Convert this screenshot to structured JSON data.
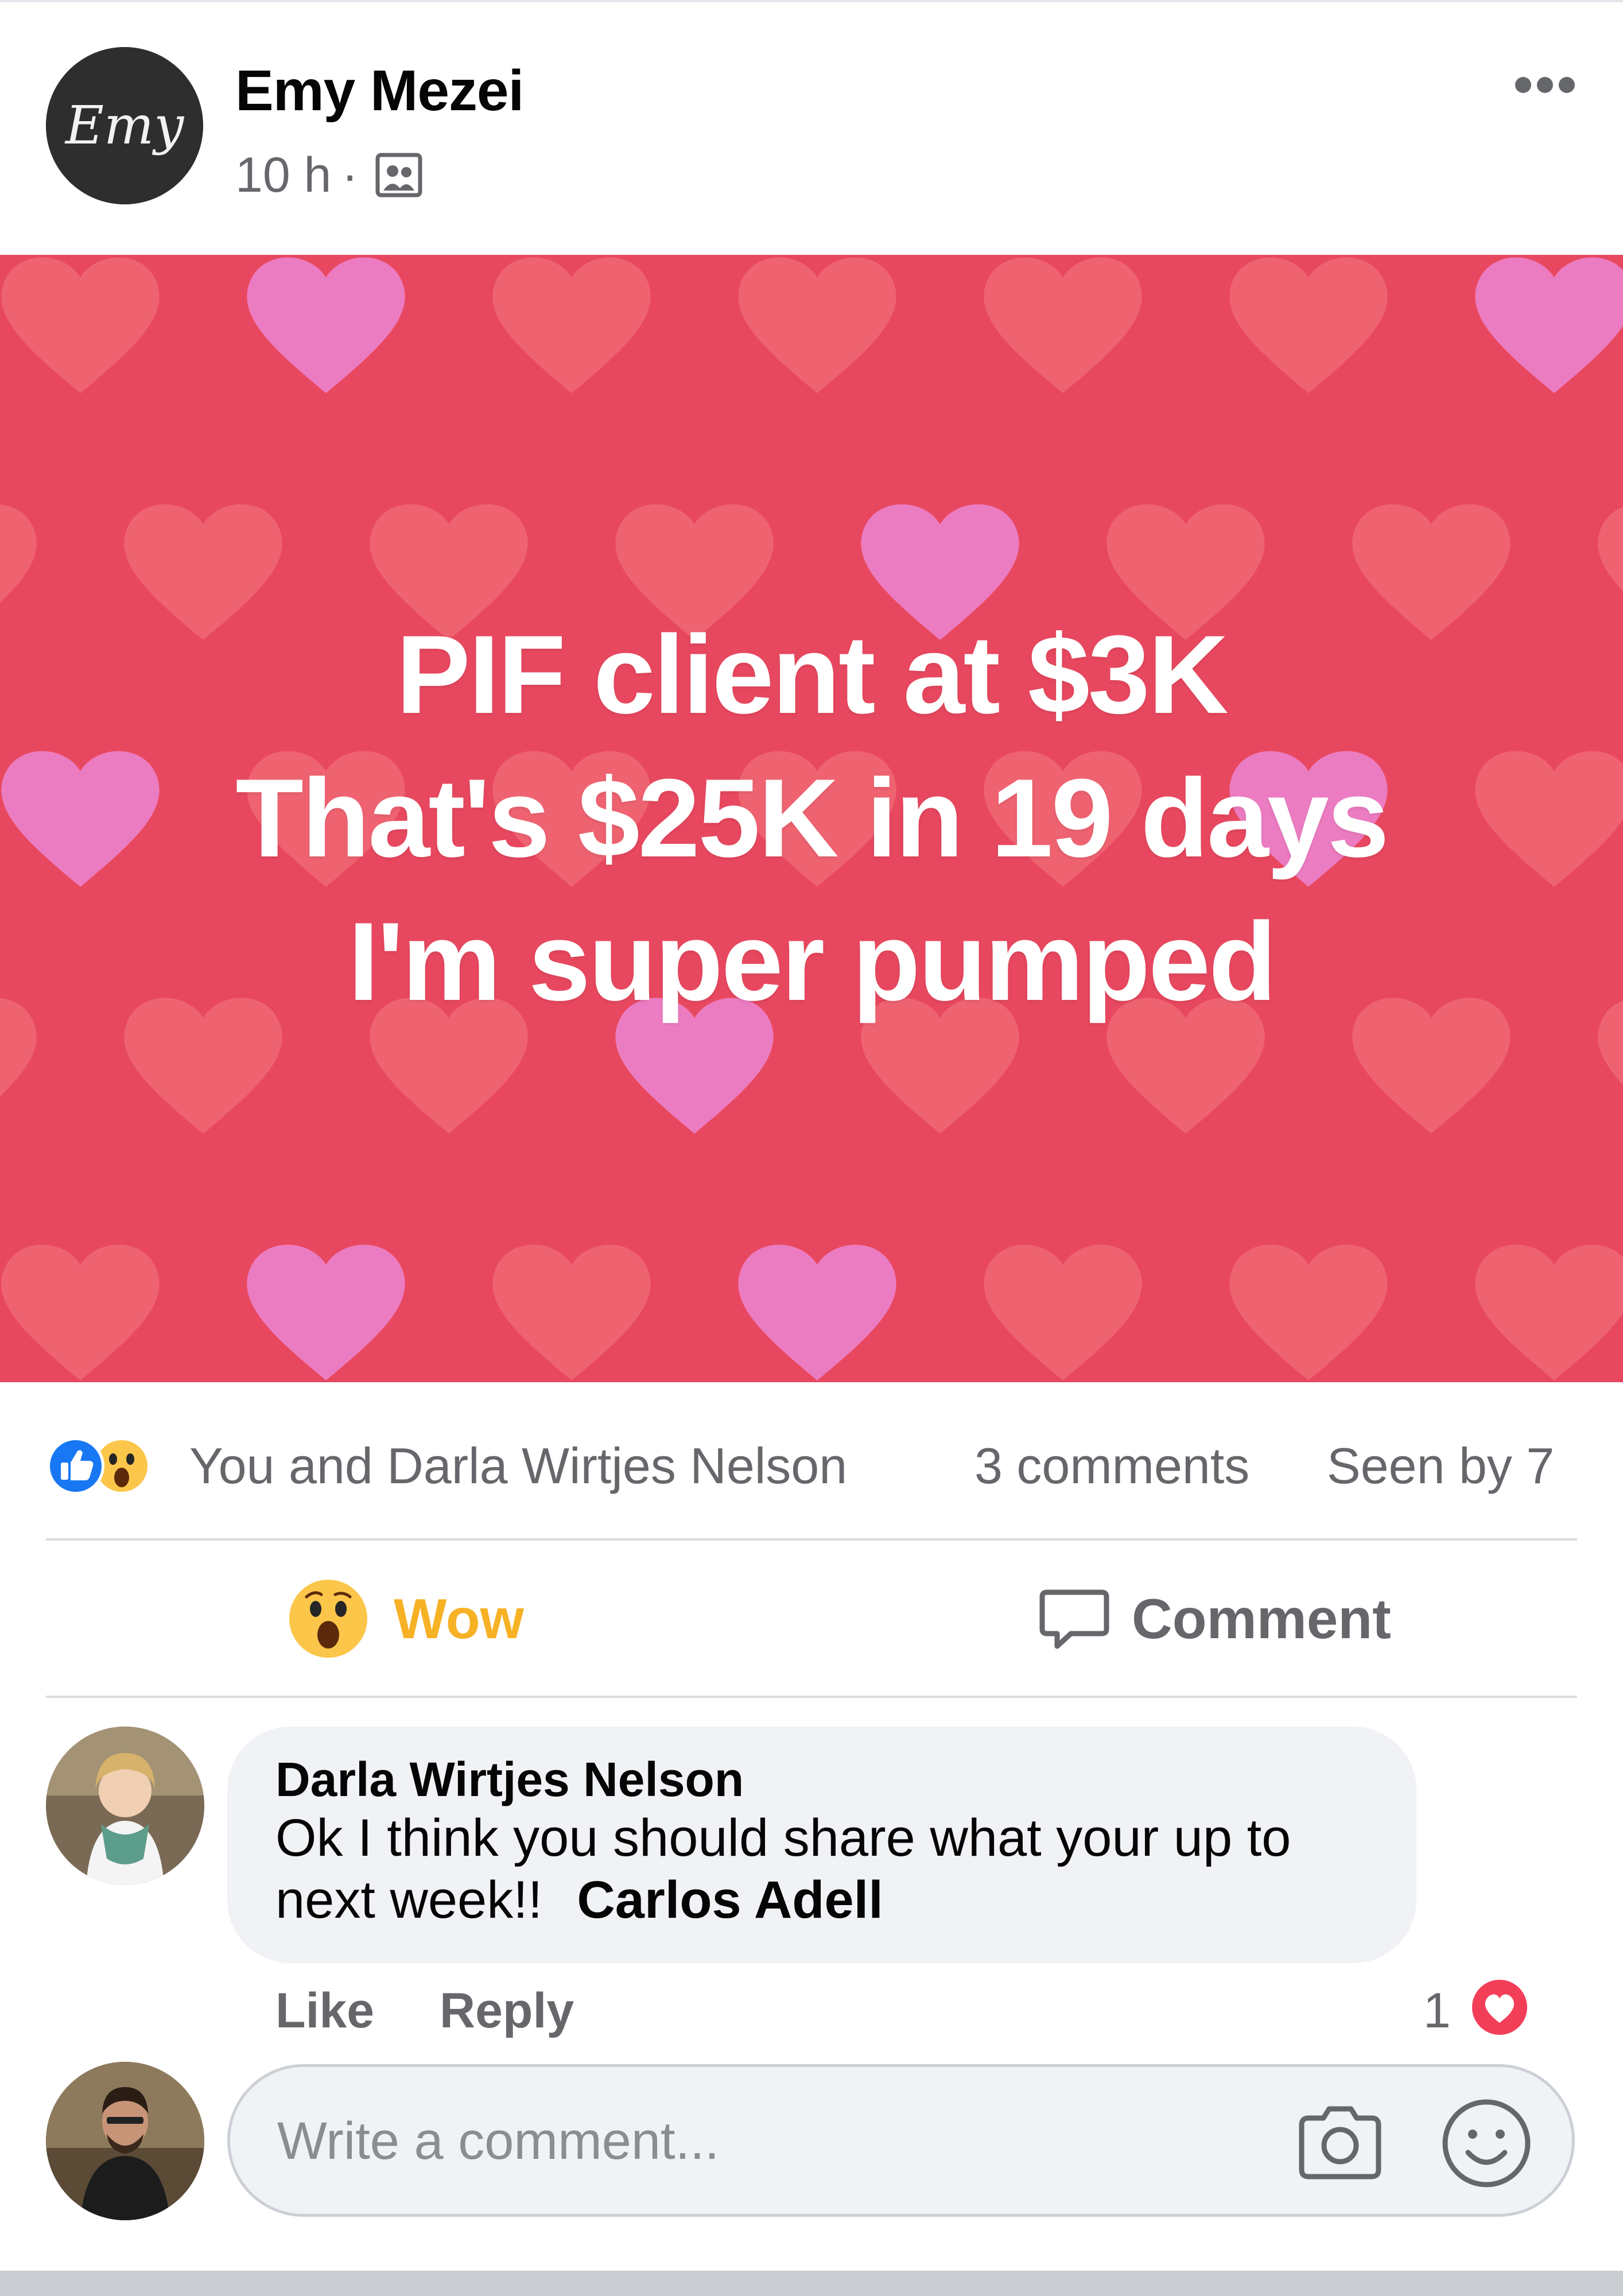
{
  "post": {
    "author_name": "Emy Mezei",
    "avatar_monogram": "Emy",
    "time": "10 h",
    "separator": "·",
    "audience_icon": "friends-group-icon",
    "more_icon": "more-horizontal-icon"
  },
  "image": {
    "lines": [
      "PIF client at $3K",
      "That's $25K in 19 days",
      "I'm super pumped"
    ],
    "background_color": "#e8485f",
    "heart_colors": [
      "#f06a75",
      "#ec7fc6"
    ]
  },
  "reactions": {
    "icons": [
      "like-icon",
      "wow-icon"
    ],
    "reactors_text": "You and Darla Wirtjes Nelson",
    "comments_count_text": "3 comments",
    "seen_by_text": "Seen by 7"
  },
  "actions": {
    "reaction_label": "Wow",
    "reaction_color": "#f7b125",
    "comment_label": "Comment"
  },
  "comments": [
    {
      "author": "Darla Wirtjes Nelson",
      "text": "Ok I think you should share what your up to next week!!",
      "mention": "Carlos Adell",
      "like_label": "Like",
      "reply_label": "Reply",
      "reaction_count": "1",
      "reaction_icon": "love-icon"
    }
  ],
  "composer": {
    "placeholder": "Write a comment...",
    "camera_icon": "camera-icon",
    "emoji_icon": "emoji-icon"
  },
  "colors": {
    "like_blue": "#1877f2",
    "love_red": "#f33e58",
    "secondary_text": "#65676b"
  }
}
